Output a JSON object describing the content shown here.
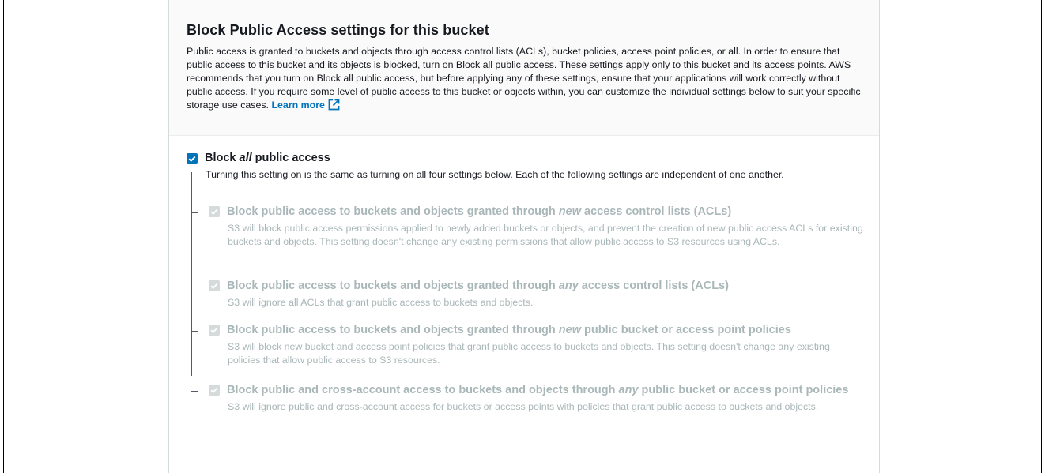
{
  "panel": {
    "title": "Block Public Access settings for this bucket",
    "description": "Public access is granted to buckets and objects through access control lists (ACLs), bucket policies, access point policies, or all. In order to ensure that public access to this bucket and its objects is blocked, turn on Block all public access. These settings apply only to this bucket and its access points. AWS recommends that you turn on Block all public access, but before applying any of these settings, ensure that your applications will work correctly without public access. If you require some level of public access to this bucket or objects within, you can customize the individual settings below to suit your specific storage use cases.",
    "learn_more": "Learn more",
    "learn_more_icon": "external-link-icon"
  },
  "block_all": {
    "label_prefix": "Block ",
    "label_emphasis": "all",
    "label_suffix": " public access",
    "checked": true,
    "description": "Turning this setting on is the same as turning on all four settings below. Each of the following settings are independent of one another."
  },
  "sub_settings": [
    {
      "label_prefix": "Block public access to buckets and objects granted through ",
      "label_emphasis": "new",
      "label_suffix": " access control lists (ACLs)",
      "description": "S3 will block public access permissions applied to newly added buckets or objects, and prevent the creation of new public access ACLs for existing buckets and objects. This setting doesn't change any existing permissions that allow public access to S3 resources using ACLs.",
      "checked": true,
      "disabled": true
    },
    {
      "label_prefix": "Block public access to buckets and objects granted through ",
      "label_emphasis": "any",
      "label_suffix": " access control lists (ACLs)",
      "description": "S3 will ignore all ACLs that grant public access to buckets and objects.",
      "checked": true,
      "disabled": true
    },
    {
      "label_prefix": "Block public access to buckets and objects granted through ",
      "label_emphasis": "new",
      "label_suffix": " public bucket or access point policies",
      "description": "S3 will block new bucket and access point policies that grant public access to buckets and objects. This setting doesn't change any existing policies that allow public access to S3 resources.",
      "checked": true,
      "disabled": true
    },
    {
      "label_prefix": "Block public and cross-account access to buckets and objects through ",
      "label_emphasis": "any",
      "label_suffix": " public bucket or access point policies",
      "description": "S3 will ignore public and cross-account access for buckets or access points with policies that grant public access to buckets and objects.",
      "checked": true,
      "disabled": true
    }
  ],
  "colors": {
    "accent": "#0073bb",
    "disabled_text": "#aab7b8",
    "disabled_checkbox": "#d5dbdb"
  }
}
